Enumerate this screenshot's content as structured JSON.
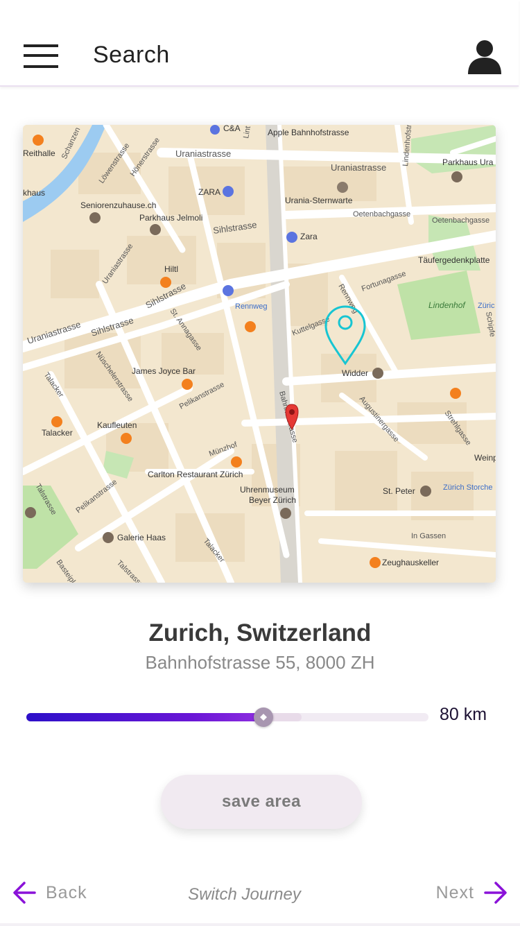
{
  "header": {
    "title": "Search",
    "menu_icon": "hamburger-menu-icon",
    "profile_icon": "user-avatar-icon"
  },
  "map": {
    "labels": {
      "reithalle": "Reithalle",
      "haus": "khaus",
      "schanzen": "Schanzen",
      "loewen": "Löwenstrasse",
      "honer": "Hönerstrasse",
      "ca": "C&A",
      "lint": "Lint",
      "apple": "Apple Bahnhofstrasse",
      "lindenhofstr": "Lindenhofstrasse",
      "uraniastr_top": "Uraniastrasse",
      "uraniastr_right": "Uraniastrasse",
      "parkhaus_ura": "Parkhaus Ura",
      "zara_top": "ZARA",
      "urania_sternwarte": "Urania-Sternwarte",
      "seniorenzuhause": "Seniorenzuhause.ch",
      "parkhaus_jelmoli": "Parkhaus Jelmoli",
      "sihlstrasse_1": "Sihlstrasse",
      "oetenbach_1": "Oetenbachgasse",
      "oetenbach_2": "Oetenbachgasse",
      "uraniastr_left": "Uraniastrasse",
      "zara_mid": "Zara",
      "taeufergedenk": "Täufergedenkplatte",
      "hiltl": "Hiltl",
      "fortunagasse": "Fortunagasse",
      "sihlstrasse_2": "Sihlstrasse",
      "rennweg": "Rennweg",
      "rennweg_street": "Rennweg",
      "lindenhof": "Lindenhof",
      "zuerich_right": "Züric",
      "schipfe": "Schipfe",
      "uraniastr_lower": "Uraniastrasse",
      "sihlstrasse_3": "Sihlstrasse",
      "st_annagasse": "St. Annagasse",
      "kuttelgasse": "Kuttelgasse",
      "widder": "Widder",
      "james_joyce": "James Joyce Bar",
      "nuescheler": "Nüschelerstrasse",
      "talacker_1": "Talacker",
      "bahnhofstrasse": "Bahnhofstrasse",
      "augustiner": "Augustinergasse",
      "strehl": "Strehlgasse",
      "pelikan_1": "Pelikanstrasse",
      "kaufleuten": "Kaufleuten",
      "talacker_2": "Talacker",
      "muenzhof": "Münzhof",
      "weinp": "Weinp",
      "carlton": "Carlton Restaurant Zürich",
      "uhrenmuseum_1": "Uhrenmuseum",
      "uhrenmuseum_2": "Beyer Zürich",
      "st_peter": "St. Peter",
      "zuerich_storch": "Zürich Storche",
      "talstrasse": "Talstrasse",
      "pelikan_2": "Pelikanstrasse",
      "galerie_haas": "Galerie Haas",
      "in_gassen": "In Gassen",
      "zeughauskeller": "Zeughauskeller",
      "talacker_3": "Talacker",
      "talstrasse_2": "Talstrasse",
      "basteipl": "Basteipl"
    },
    "search_area_pin_color": "#17c5d2",
    "location_pin_color": "#e53935"
  },
  "location": {
    "name": "Zurich, Switzerland",
    "address": "Bahnhofstrasse 55, 8000 ZH"
  },
  "radius": {
    "value_text": "80 km",
    "fraction": 0.59
  },
  "actions": {
    "save_label": "save area"
  },
  "footer": {
    "back_label": "Back",
    "journey_label": "Switch Journey",
    "next_label": "Next",
    "arrow_color": "#8a12d8"
  }
}
